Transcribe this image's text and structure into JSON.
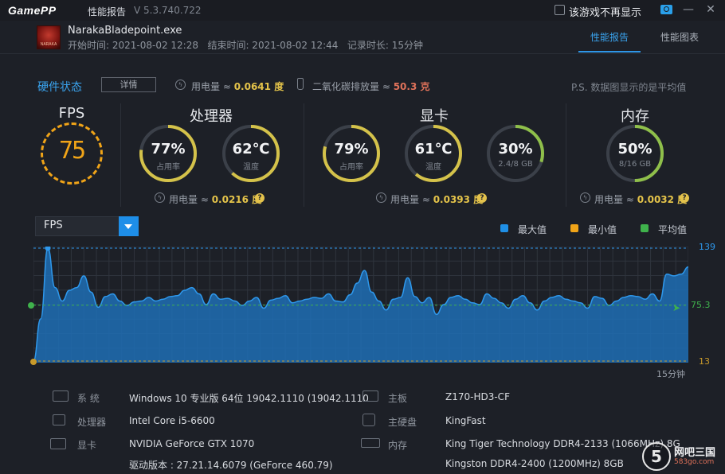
{
  "app": {
    "logo": "GamePP",
    "title": "性能报告",
    "version": "V 5.3.740.722",
    "hide_label": "该游戏不再显示"
  },
  "session": {
    "exe": "NarakaBladepoint.exe",
    "icon_text": "NARAKA",
    "start": "开始时间: 2021-08-02 12:28",
    "end": "结束时间: 2021-08-02 12:44",
    "duration": "记录时长: 15分钟"
  },
  "tabs": [
    {
      "label": "性能报告",
      "active": true
    },
    {
      "label": "性能图表",
      "active": false
    }
  ],
  "summary": {
    "hw_status": "硬件状态",
    "detail_button": "详情",
    "power_label": "用电量 ≈",
    "power_value": "0.0641 度",
    "co2_label": "二氧化碳排放量 ≈",
    "co2_value": "50.3 克",
    "note": "P.S. 数据图显示的是平均值"
  },
  "fps_card": {
    "title": "FPS",
    "value": "75"
  },
  "cpu_card": {
    "title": "处理器",
    "usage": {
      "value": "77%",
      "label": "占用率",
      "fraction": 0.77
    },
    "temp": {
      "value": "62℃",
      "label": "温度",
      "fraction": 0.62
    },
    "power_label": "用电量 ≈",
    "power_value": "0.0216 度"
  },
  "gpu_card": {
    "title": "显卡",
    "usage": {
      "value": "79%",
      "label": "占用率",
      "fraction": 0.79
    },
    "temp": {
      "value": "61℃",
      "label": "温度",
      "fraction": 0.61
    },
    "vram": {
      "value": "30%",
      "label": "2.4/8 GB",
      "fraction": 0.3
    },
    "power_label": "用电量 ≈",
    "power_value": "0.0393 度"
  },
  "mem_card": {
    "title": "内存",
    "usage": {
      "value": "50%",
      "label": "8/16 GB",
      "fraction": 0.5
    },
    "power_label": "用电量 ≈",
    "power_value": "0.0032 度"
  },
  "chart_controls": {
    "metric": "FPS",
    "legend": [
      {
        "label": "最大值",
        "color": "#1f8fe6"
      },
      {
        "label": "最小值",
        "color": "#f0a418"
      },
      {
        "label": "平均值",
        "color": "#3fb24c"
      }
    ]
  },
  "chart_data": {
    "type": "area",
    "series": [
      {
        "values": [
          13,
          60,
          139,
          95,
          80,
          92,
          95,
          108,
          90,
          73,
          85,
          88,
          80,
          75,
          79,
          80,
          84,
          80,
          82,
          85,
          86,
          92,
          95,
          88,
          76,
          88,
          82,
          83,
          80,
          75,
          80,
          84,
          72,
          81,
          83,
          86,
          78,
          80,
          82,
          84,
          83,
          88,
          80,
          79,
          87,
          100,
          114,
          90,
          80,
          70,
          82,
          84,
          106,
          85,
          78,
          84,
          65,
          76,
          84,
          86,
          82,
          78,
          76,
          88,
          83,
          78,
          72,
          82,
          86,
          78,
          70,
          80,
          84,
          86,
          82,
          80,
          78,
          72,
          85,
          83,
          75,
          80,
          84,
          86,
          85,
          82,
          88,
          80,
          110,
          108,
          110,
          118
        ]
      }
    ],
    "ylim": [
      13,
      139
    ],
    "y_ticks": [
      "139",
      "75.3",
      "13"
    ],
    "max": 139,
    "avg": 75.3,
    "min": 13,
    "x_end_label": "15分钟",
    "colors": {
      "fill": "#1f6fb5",
      "line": "#2e98ec",
      "max_line": "#2e98ec",
      "avg_line": "#3fb24c",
      "min_line": "#c99a2a"
    }
  },
  "system_info": [
    {
      "key": "系 统",
      "value": "Windows 10 专业版 64位  19042.1110 (19042.1110"
    },
    {
      "key": "处理器",
      "value": "Intel Core i5-6600"
    },
    {
      "key": "显卡",
      "value": "NVIDIA GeForce GTX 1070"
    },
    {
      "key": "",
      "value": "驱动版本 : 27.21.14.6079 (GeForce 460.79)"
    },
    {
      "key": "主板",
      "value": "Z170-HD3-CF"
    },
    {
      "key": "主硬盘",
      "value": "KingFast"
    },
    {
      "key": "内存",
      "value": "King Tiger Technology DDR4-2133 (1066MHz) 8G"
    },
    {
      "key": "",
      "value": "Kingston DDR4-2400 (1200MHz) 8GB"
    }
  ],
  "watermark": {
    "text": "网吧三国",
    "sub": "583go.com"
  }
}
